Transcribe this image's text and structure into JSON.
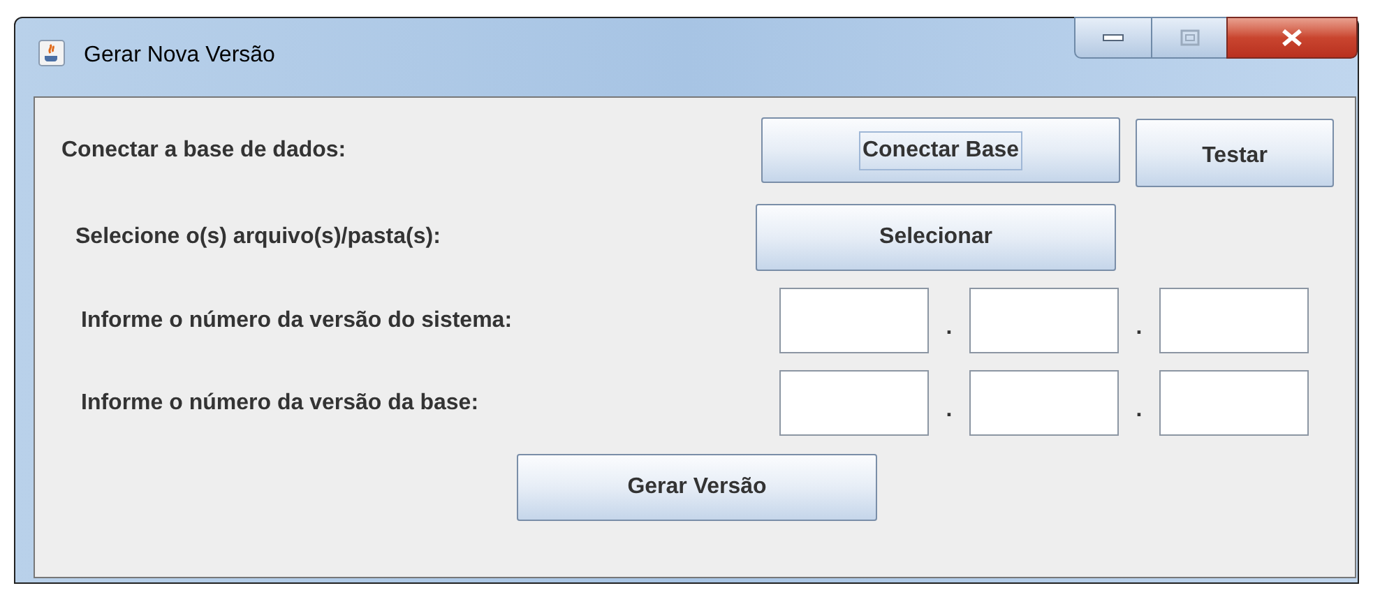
{
  "window": {
    "title": "Gerar Nova Versão"
  },
  "connect_row": {
    "label": "Conectar a base de dados:",
    "buttons": [
      {
        "label": "Conectar Base",
        "focused": true
      },
      {
        "label": "Testar",
        "focused": false
      }
    ]
  },
  "select_row": {
    "label": "Selecione o(s) arquivo(s)/pasta(s):",
    "button": {
      "label": "Selecionar"
    }
  },
  "version_rows": [
    {
      "label": "Informe o número da versão do sistema:",
      "separators": [
        ".",
        "."
      ]
    },
    {
      "label": "Informe o número da versão da base:",
      "separators": [
        ".",
        "."
      ]
    }
  ],
  "generate_button": {
    "label": "Gerar Versão"
  }
}
